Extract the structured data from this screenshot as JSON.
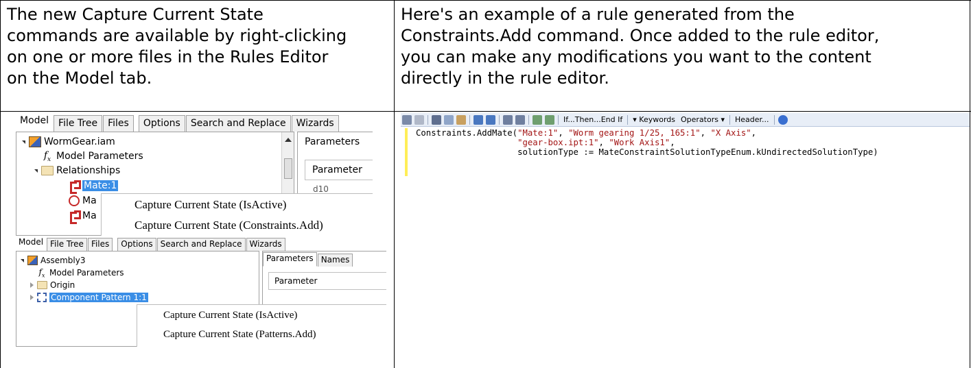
{
  "cells": {
    "left_description": "The new Capture Current State\ncommands are available by right-clicking\non one or more files in the Rules Editor\non the Model tab.",
    "right_description": "Here's an example of a rule generated from the\nConstraints.Add command. Once added to the rule editor,\nyou can make any modifications you want to the content\ndirectly in the rule editor."
  },
  "shot1": {
    "tabs": [
      "Model",
      "File Tree",
      "Files",
      "Options",
      "Search and Replace",
      "Wizards"
    ],
    "tree": {
      "root": "WormGear.iam",
      "model_parameters": "Model Parameters",
      "relationships": "Relationships",
      "mate_selected": "Mate:1",
      "mate_2": "Ma",
      "mate_3": "Ma"
    },
    "right_panel_title": "Parameters",
    "right_panel_header": "Parameter",
    "right_panel_partial": "d10",
    "context_menu": [
      "Capture Current State (IsActive)",
      "Capture Current State (Constraints.Add)"
    ]
  },
  "shot2": {
    "tabs": [
      "Model",
      "File Tree",
      "Files",
      "Options",
      "Search and Replace",
      "Wizards"
    ],
    "tree": {
      "root": "Assembly3",
      "model_parameters": "Model Parameters",
      "origin": "Origin",
      "component_pattern": "Component Pattern 1:1"
    },
    "right_tabs": [
      "Parameters",
      "Names"
    ],
    "right_panel_header": "Parameter",
    "context_menu": [
      "Capture Current State (IsActive)",
      "Capture Current State (Patterns.Add)"
    ]
  },
  "editor": {
    "toolbar": {
      "if_then": "If...Then...End If",
      "keywords": "Keywords",
      "operators": "Operators",
      "header": "Header..."
    },
    "code_lines": [
      [
        "Constraints.AddMate(",
        "\"Mate:1\"",
        ", ",
        "\"Worm gearing 1/25, 165:1\"",
        ", ",
        "\"X Axis\"",
        ","
      ],
      [
        "                    ",
        "\"gear-box.ipt:1\"",
        ", ",
        "\"Work Axis1\"",
        ","
      ],
      [
        "                    solutionType := MateConstraintSolutionTypeEnum.kUndirectedSolutionType)"
      ]
    ]
  },
  "colors": {
    "selection": "#3a8ee6",
    "string_literal": "#a31515",
    "gutter_marker": "#ffee58"
  }
}
